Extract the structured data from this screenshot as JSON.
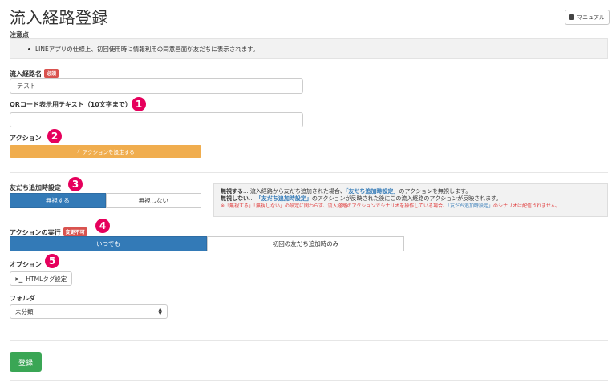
{
  "header": {
    "title": "流入経路登録",
    "manual_label": "マニュアル"
  },
  "notice": {
    "label": "注意点",
    "text": "LINEアプリの仕様上、初回使用時に情報利用の同意画面が友だちに表示されます。"
  },
  "route_name": {
    "label": "流入経路名",
    "required_badge": "必須",
    "value": "テスト"
  },
  "qr_text": {
    "label": "QRコード表示用テキスト（10文字まで）",
    "value": ""
  },
  "action": {
    "label": "アクション",
    "button_label": "アクションを設定する"
  },
  "friend_setting": {
    "label": "友だち追加時設定",
    "options": [
      "無視する",
      "無視しない"
    ],
    "selected": "無視する"
  },
  "info_box": {
    "line1_term": "無視する",
    "line1_a": "... 流入経路から友だち追加された場合、",
    "line1_link": "「友だち追加時設定」",
    "line1_b": "のアクションを無視します。",
    "line2_term": "無視しない",
    "line2_a": "... ",
    "line2_link": "「友だち追加時設定」",
    "line2_b": "のアクションが反映された後にこの流入経路のアクションが反映されます。",
    "warn_a": "※「無視する」「無視しない」の設定に関わらず、流入経路のアクションでシナリオを操作している場合、",
    "warn_link": "「友だち追加時設定」",
    "warn_b": "のシナリオは配信されません。"
  },
  "execution": {
    "label": "アクションの実行",
    "badge": "変更不可",
    "options": [
      "いつでも",
      "初回の友だち追加時のみ"
    ],
    "selected": "いつでも"
  },
  "options_section": {
    "label": "オプション",
    "html_button_label": "HTMLタグ設定"
  },
  "folder": {
    "label": "フォルダ",
    "selected": "未分類"
  },
  "submit_label": "登録",
  "annotations": [
    "1",
    "2",
    "3",
    "4",
    "5"
  ],
  "colors": {
    "primary": "#337ab7",
    "warning": "#f0ad4e",
    "success": "#3aa655",
    "danger": "#d9534f",
    "annotation": "#e6005c"
  }
}
